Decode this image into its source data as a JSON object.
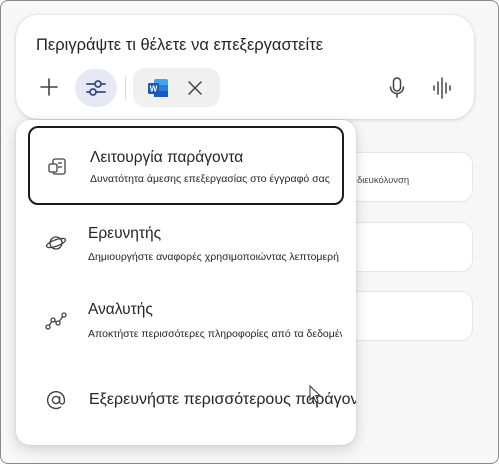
{
  "composer": {
    "prompt_text": "Περιγράψτε τι θέλετε να επεξεργαστείτε",
    "add_icon": "plus-icon",
    "tools_icon": "sliders-icon",
    "attachment": {
      "icon": "word-document-icon",
      "remove_icon": "close-icon"
    },
    "mic_icon": "microphone-icon",
    "voice_icon": "waveform-icon"
  },
  "background_cards": [
    {
      "text": "διευκόλυνση"
    },
    {
      "text": ""
    },
    {
      "text": ""
    }
  ],
  "agents_menu": {
    "items": [
      {
        "icon": "document-agent-icon",
        "title": "Λειτουργία παράγοντα",
        "description": "Δυνατότητα άμεσης επεξεργασίας στο έγγραφό σας",
        "selected": true
      },
      {
        "icon": "planet-icon",
        "title": "Ερευνητής",
        "description": "Δημιουργήστε αναφορές χρησιμοποιώντας λεπτομερή πρωκτικό..."
      },
      {
        "icon": "trend-line-icon",
        "title": "Αναλυτής",
        "description": "Αποκτήστε περισσότερες πληροφορίες από τα δεδομένα σας"
      },
      {
        "icon": "at-sign-icon",
        "title": "Εξερευνήστε περισσότερους παράγοντες"
      }
    ]
  },
  "colors": {
    "accent_bg": "#e6e8f3",
    "accent": "#3b4a8c",
    "word_blue": "#185abd"
  }
}
